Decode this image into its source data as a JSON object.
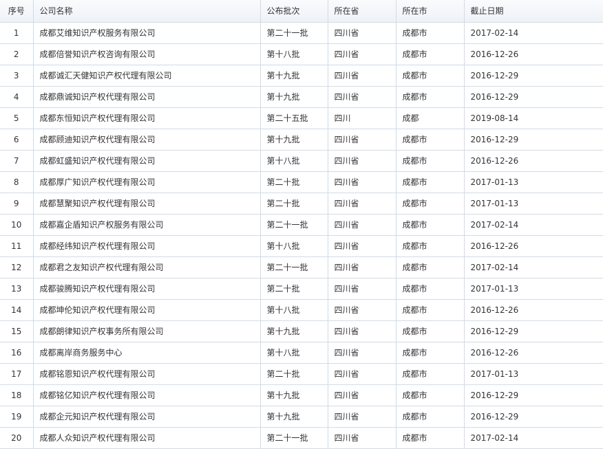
{
  "table": {
    "headers": [
      "序号",
      "公司名称",
      "公布批次",
      "所在省",
      "所在市",
      "截止日期"
    ],
    "rows": [
      [
        "1",
        "成都艾维知识产权服务有限公司",
        "第二十一批",
        "四川省",
        "成都市",
        "2017-02-14"
      ],
      [
        "2",
        "成都倍誉知识产权咨询有限公司",
        "第十八批",
        "四川省",
        "成都市",
        "2016-12-26"
      ],
      [
        "3",
        "成都诚汇天健知识产权代理有限公司",
        "第十九批",
        "四川省",
        "成都市",
        "2016-12-29"
      ],
      [
        "4",
        "成都鼎诚知识产权代理有限公司",
        "第十九批",
        "四川省",
        "成都市",
        "2016-12-29"
      ],
      [
        "5",
        "成都东恒知识产权代理有限公司",
        "第二十五批",
        "四川",
        "成都",
        "2019-08-14"
      ],
      [
        "6",
        "成都顾迪知识产权代理有限公司",
        "第十九批",
        "四川省",
        "成都市",
        "2016-12-29"
      ],
      [
        "7",
        "成都虹盛知识产权代理有限公司",
        "第十八批",
        "四川省",
        "成都市",
        "2016-12-26"
      ],
      [
        "8",
        "成都厚广知识产权代理有限公司",
        "第二十批",
        "四川省",
        "成都市",
        "2017-01-13"
      ],
      [
        "9",
        "成都慧聚知识产权代理有限公司",
        "第二十批",
        "四川省",
        "成都市",
        "2017-01-13"
      ],
      [
        "10",
        "成都嘉企盾知识产权服务有限公司",
        "第二十一批",
        "四川省",
        "成都市",
        "2017-02-14"
      ],
      [
        "11",
        "成都经纬知识产权代理有限公司",
        "第十八批",
        "四川省",
        "成都市",
        "2016-12-26"
      ],
      [
        "12",
        "成都君之友知识产权代理有限公司",
        "第二十一批",
        "四川省",
        "成都市",
        "2017-02-14"
      ],
      [
        "13",
        "成都骏腾知识产权代理有限公司",
        "第二十批",
        "四川省",
        "成都市",
        "2017-01-13"
      ],
      [
        "14",
        "成都坤伦知识产权代理有限公司",
        "第十八批",
        "四川省",
        "成都市",
        "2016-12-26"
      ],
      [
        "15",
        "成都朗律知识产权事务所有限公司",
        "第十九批",
        "四川省",
        "成都市",
        "2016-12-29"
      ],
      [
        "16",
        "成都离岸商务服务中心",
        "第十八批",
        "四川省",
        "成都市",
        "2016-12-26"
      ],
      [
        "17",
        "成都铭恩知识产权代理有限公司",
        "第二十批",
        "四川省",
        "成都市",
        "2017-01-13"
      ],
      [
        "18",
        "成都铭亿知识产权代理有限公司",
        "第十九批",
        "四川省",
        "成都市",
        "2016-12-29"
      ],
      [
        "19",
        "成都企元知识产权代理有限公司",
        "第十九批",
        "四川省",
        "成都市",
        "2016-12-29"
      ],
      [
        "20",
        "成都人众知识产权代理有限公司",
        "第二十一批",
        "四川省",
        "成都市",
        "2017-02-14"
      ]
    ]
  }
}
